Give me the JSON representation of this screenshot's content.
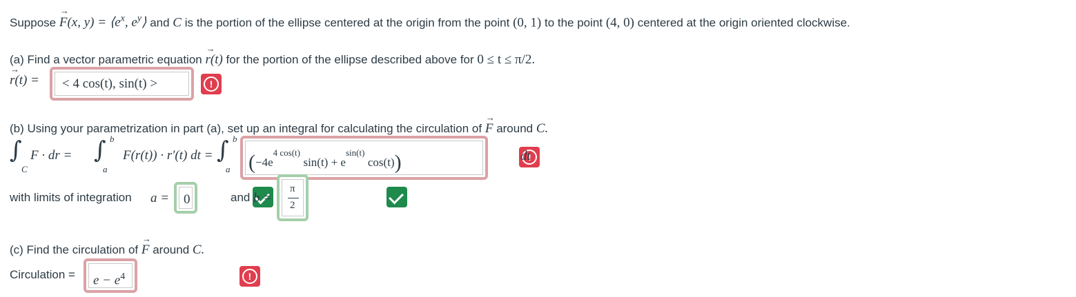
{
  "problem": {
    "intro_prefix": "Suppose",
    "field_def": "F(x, y) = ⟨e",
    "intro_suffix": "and",
    "intro_curve": "C",
    "intro_rest": "is the portion of the ellipse centered at the origin from the point",
    "point1": "(0, 1)",
    "to_text": "to the point",
    "point2": "(4, 0)",
    "intro_end": "centered at the origin oriented clockwise."
  },
  "part_a": {
    "prompt": "(a) Find a vector parametric equation",
    "rt": "r(t)",
    "prompt_end": "for the portion of the ellipse described above for",
    "range": "0 ≤ t ≤ π/2.",
    "label": "r(t) =",
    "answer": "< 4 cos(t), sin(t) >",
    "status": "incorrect"
  },
  "part_b": {
    "prompt": "(b) Using your parametrization in part (a), set up an integral for calculating the circulation of",
    "prompt_F": "F",
    "prompt_around": "around",
    "prompt_C": "C.",
    "lhs": "F · dr =",
    "mid": "F(r(t)) · r′(t) dt =",
    "answer_neg4e": "−4e",
    "answer_exp1": "4 cos(t)",
    "answer_sin": "sin(t) + e",
    "answer_exp2": "sin(t)",
    "answer_cos": "cos(t)",
    "dt": "dt",
    "limits_label": "with limits of integration",
    "a_label": "a =",
    "a_value": "0",
    "and_label": "and",
    "b_label": "b =",
    "b_num": "π",
    "b_den": "2",
    "status_integrand": "incorrect",
    "status_a": "correct",
    "status_b": "correct"
  },
  "part_c": {
    "prompt": "(c) Find the circulation of",
    "prompt_F": "F",
    "prompt_around": "around",
    "prompt_C": "C.",
    "label": "Circulation =",
    "answer_base": "e − e",
    "answer_exp": "4",
    "status": "incorrect"
  },
  "colors": {
    "incorrect": "#e03e4e",
    "correct": "#1e8a4c",
    "incorrect_border": "#dba2a6",
    "correct_border": "#a4cfaa"
  }
}
